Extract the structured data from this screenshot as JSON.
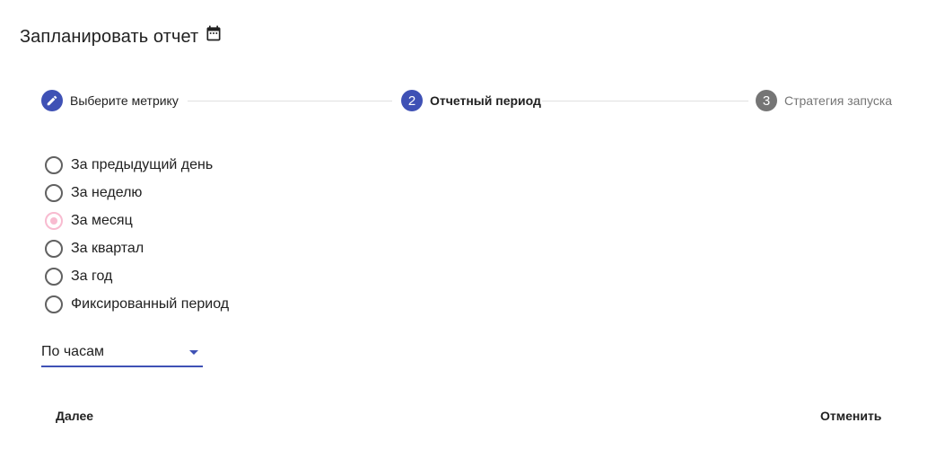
{
  "dialog": {
    "title": "Запланировать отчет"
  },
  "stepper": {
    "steps": [
      {
        "label": "Выберите метрику",
        "state": "done",
        "icon": "pencil-icon"
      },
      {
        "number": "2",
        "label": "Отчетный период",
        "state": "active"
      },
      {
        "number": "3",
        "label": "Стратегия запуска",
        "state": "pending"
      }
    ]
  },
  "period_options": [
    {
      "label": "За предыдущий день",
      "selected": false
    },
    {
      "label": "За неделю",
      "selected": false
    },
    {
      "label": "За месяц",
      "selected": true
    },
    {
      "label": "За квартал",
      "selected": false
    },
    {
      "label": "За год",
      "selected": false
    },
    {
      "label": "Фиксированный период",
      "selected": false
    }
  ],
  "granularity_select": {
    "value": "По часам"
  },
  "actions": {
    "next_label": "Далее",
    "cancel_label": "Отменить"
  },
  "colors": {
    "primary": "#3f51b5",
    "pending_step": "#757575",
    "selected_radio": "#f8bbd0",
    "divider": "#e0e0e0"
  }
}
